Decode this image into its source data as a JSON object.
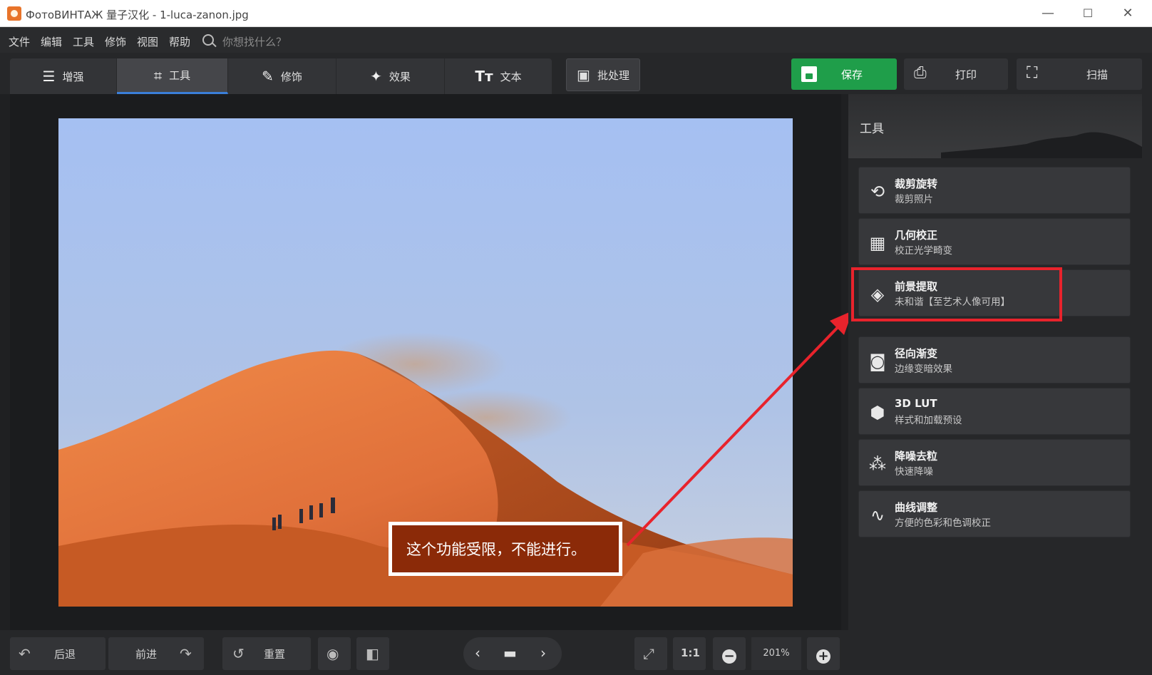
{
  "window": {
    "title": "ФотоВИНТАЖ 量子汉化 - 1-luca-zanon.jpg",
    "minimize": "—",
    "maximize": "☐",
    "close": "✕"
  },
  "menu": {
    "items": [
      "文件",
      "编辑",
      "工具",
      "修饰",
      "视图",
      "帮助"
    ],
    "search_placeholder": "你想找什么？"
  },
  "tabs": [
    {
      "label": "增强",
      "icon": "sliders-icon"
    },
    {
      "label": "工具",
      "icon": "crop-icon"
    },
    {
      "label": "修饰",
      "icon": "brush-icon"
    },
    {
      "label": "效果",
      "icon": "magic-wand-icon"
    },
    {
      "label": "文本",
      "icon": "text-icon"
    }
  ],
  "batch": {
    "label": "批处理"
  },
  "actions": {
    "save": "保存",
    "print": "打印",
    "scan": "扫描"
  },
  "panel": {
    "title": "工具",
    "tools": [
      {
        "title": "裁剪旋转",
        "subtitle": "裁剪照片"
      },
      {
        "title": "几何校正",
        "subtitle": "校正光学畸变"
      },
      {
        "title": "前景提取",
        "subtitle": "未和谐【至艺术人像可用】"
      },
      {
        "title": "径向渐变",
        "subtitle": "边缘变暗效果"
      },
      {
        "title": "3D LUT",
        "subtitle": "样式和加载预设"
      },
      {
        "title": "降噪去粒",
        "subtitle": "快速降噪"
      },
      {
        "title": "曲线调整",
        "subtitle": "方便的色彩和色调校正"
      }
    ]
  },
  "annotation": {
    "text": "这个功能受限，不能进行。"
  },
  "bottom": {
    "undo": "后退",
    "redo": "前进",
    "reset": "重置",
    "ratio": "1:1",
    "zoom": "201%"
  },
  "colors": {
    "accent": "#3b7fd9",
    "save": "#1f9e4a",
    "highlight": "#e8232c"
  }
}
